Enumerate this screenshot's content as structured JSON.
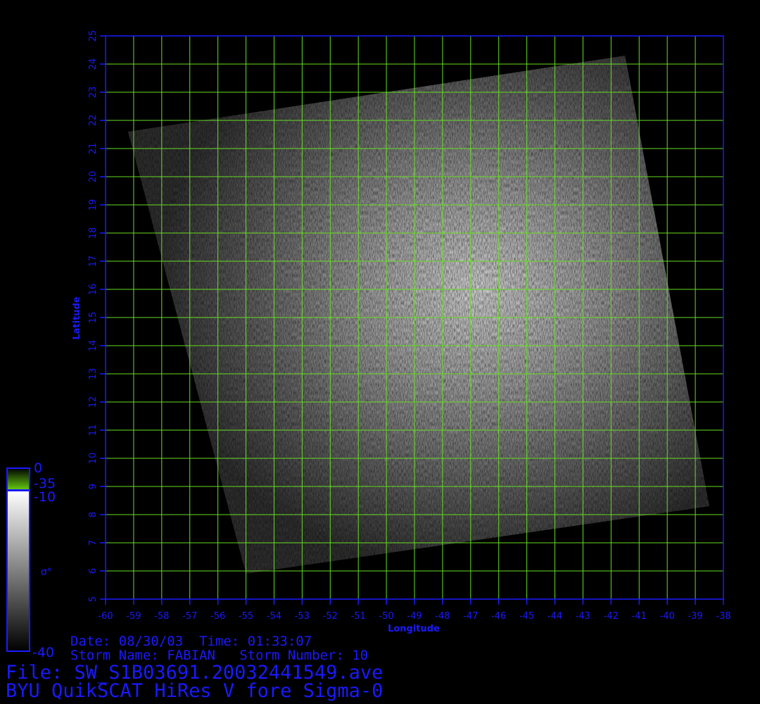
{
  "colors": {
    "background": "#000000",
    "text": "#1a1aff",
    "grid": "#66dd22",
    "border": "#1a1aff"
  },
  "plot": {
    "x_label": "Longitude",
    "y_label": "Latitude",
    "x_ticks": [
      "-60",
      "-59",
      "-58",
      "-57",
      "-56",
      "-55",
      "-54",
      "-53",
      "-52",
      "-51",
      "-50",
      "-49",
      "-48",
      "-47",
      "-46",
      "-45",
      "-44",
      "-43",
      "-42",
      "-41",
      "-40",
      "-39",
      "-38"
    ],
    "y_ticks": [
      "5",
      "6",
      "7",
      "8",
      "9",
      "10",
      "11",
      "12",
      "13",
      "14",
      "15",
      "16",
      "17",
      "18",
      "19",
      "20",
      "21",
      "22",
      "23",
      "24",
      "25"
    ],
    "lon_range": [
      -60,
      -38
    ],
    "lat_range": [
      5,
      25
    ],
    "grid": true,
    "swath_corners": [
      {
        "lon": -59.2,
        "lat": 21.6
      },
      {
        "lon": -41.5,
        "lat": 24.3
      },
      {
        "lon": -38.5,
        "lat": 8.3
      },
      {
        "lon": -55.0,
        "lat": 5.9
      }
    ]
  },
  "colorbar": {
    "labels": [
      "0",
      "-35",
      "-10",
      "-40"
    ],
    "symbol": "σ°"
  },
  "info": {
    "date_line": "Date: 08/30/03  Time: 01:33:07",
    "storm_line": "Storm Name: FABIAN   Storm Number: 10",
    "file_line": "File: SW_S1B03691.20032441549.ave",
    "product_line": "BYU QuikSCAT HiRes V fore Sigma-0"
  }
}
